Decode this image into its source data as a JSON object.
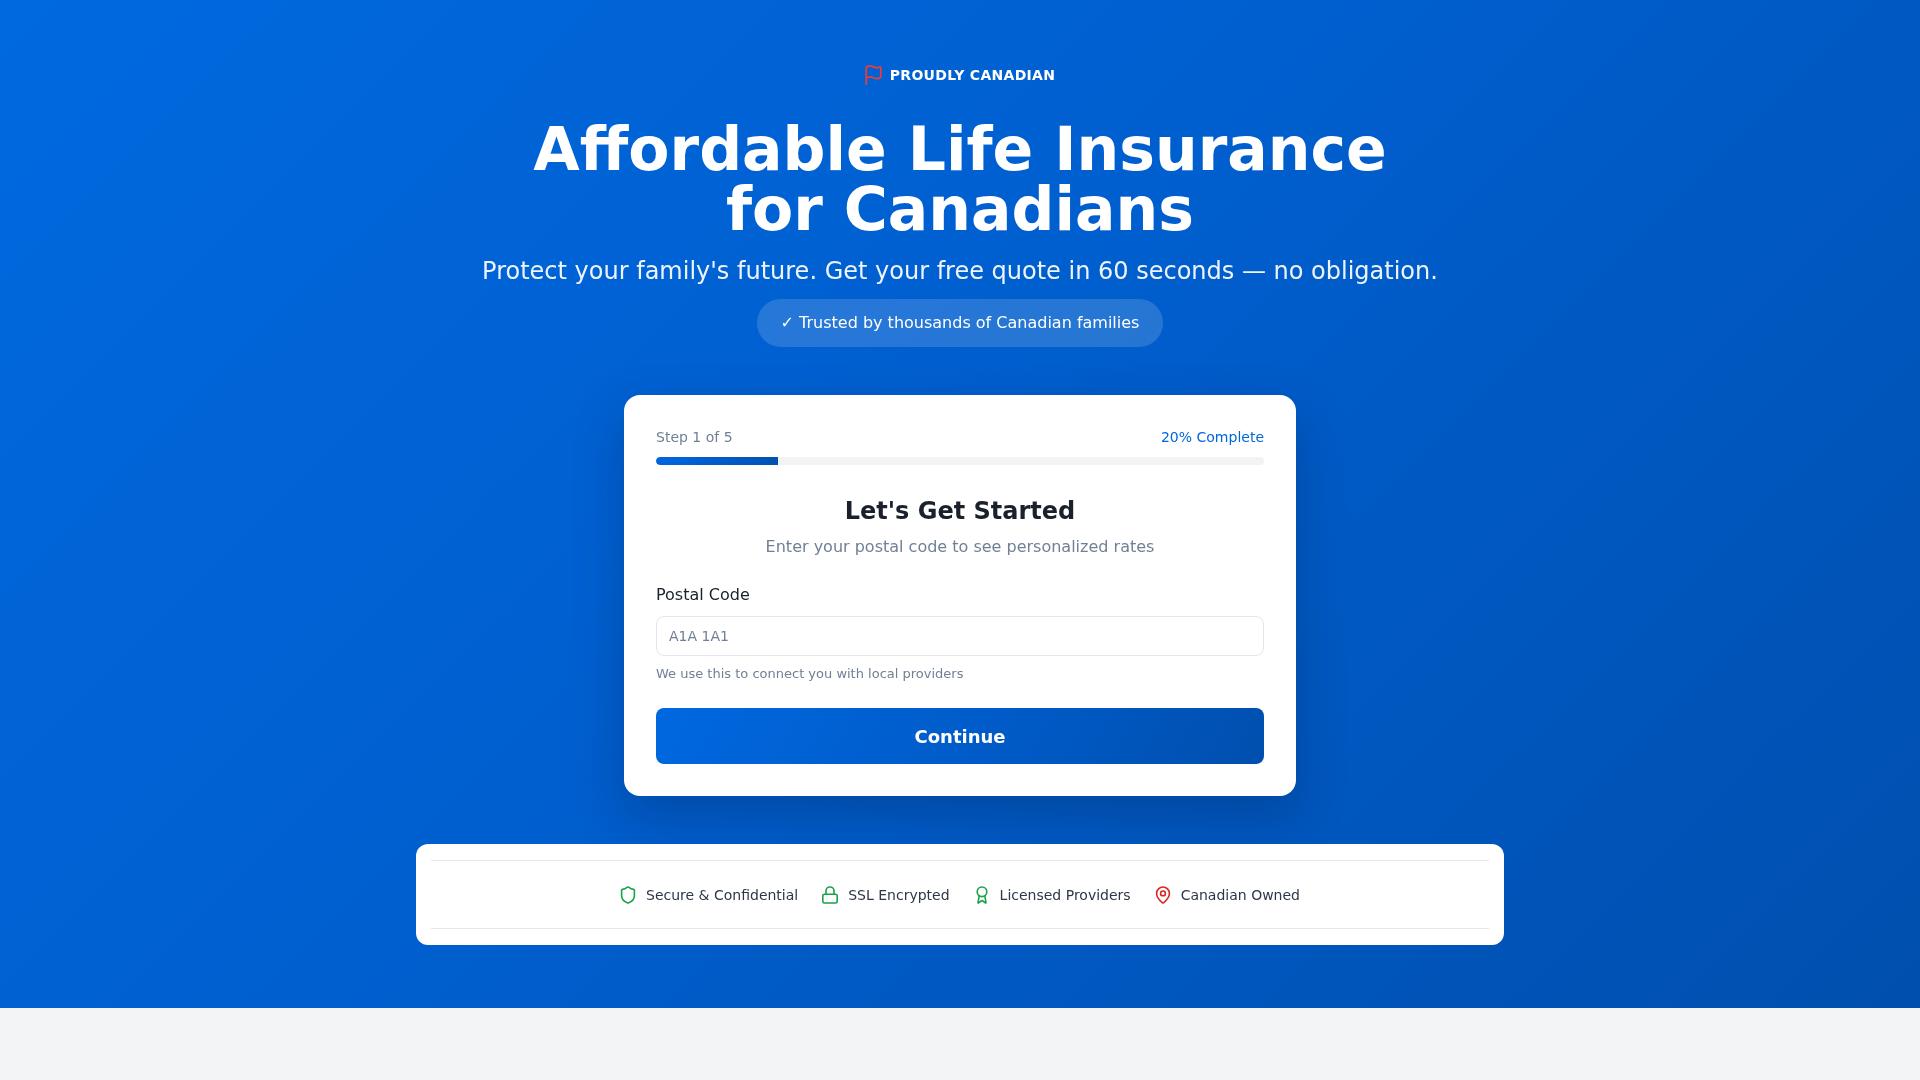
{
  "hero": {
    "badge": "PROUDLY CANADIAN",
    "title": "Affordable Life Insurance for Canadians",
    "subtitle": "Protect your family's future. Get your free quote in 60 seconds — no obligation.",
    "trust_pill": "✓ Trusted by thousands of Canadian families"
  },
  "form_card": {
    "step_label": "Step 1 of 5",
    "progress_label": "20% Complete",
    "progress": {
      "level": 0.2
    },
    "heading": "Let's Get Started",
    "subheading": "Enter your postal code to see personalized rates",
    "field": {
      "label": "Postal Code",
      "placeholder": "A1A 1A1",
      "hint": "We use this to connect you with local providers"
    },
    "button": "Continue"
  },
  "trust_badges": [
    {
      "kind": "shield",
      "label": "Secure & Confidential",
      "color": "#16a34a"
    },
    {
      "kind": "lock",
      "label": "SSL Encrypted",
      "color": "#16a34a"
    },
    {
      "kind": "award",
      "label": "Licensed Providers",
      "color": "#16a34a"
    },
    {
      "kind": "pin",
      "label": "Canadian Owned",
      "color": "#dc2626"
    }
  ]
}
